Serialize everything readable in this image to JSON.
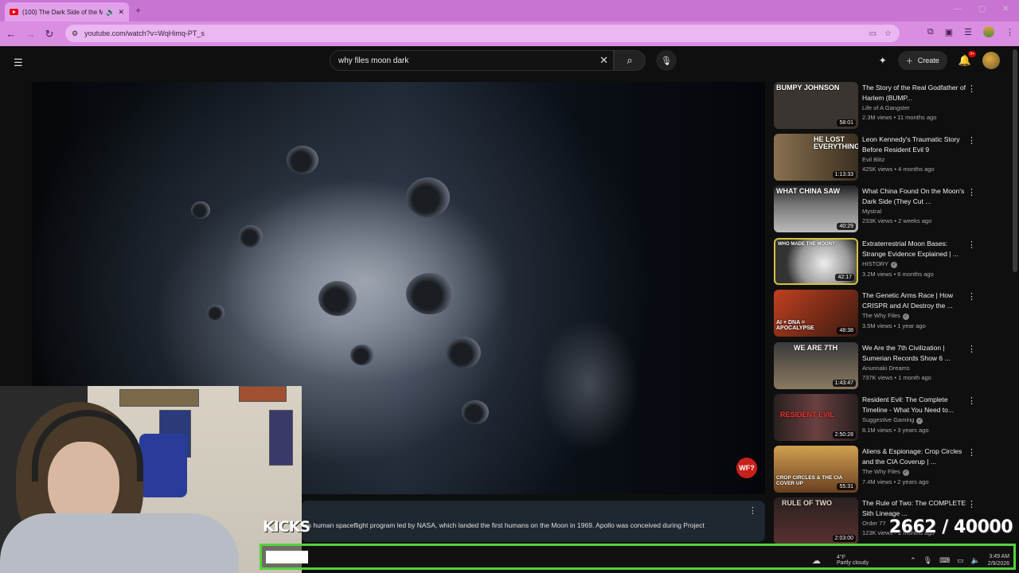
{
  "browser": {
    "tab_title": "(100) The Dark Side of the M",
    "url": "youtube.com/watch?v=WqHimq-PT_s",
    "new_tab_glyph": "+",
    "window_controls": [
      "—",
      "▢",
      "✕"
    ]
  },
  "youtube": {
    "search_query": "why files moon dark",
    "create_label": "Create",
    "notification_count": "9+"
  },
  "player": {
    "channel_badge": "WF?"
  },
  "description": {
    "text": "es human spaceflight program led by NASA, which landed the first humans on the Moon in 1969. Apollo was conceived during Project"
  },
  "recommendations": [
    {
      "title": "The Story of the Real Godfather of Harlem (BUMP...",
      "channel": "Life of A Gangster",
      "meta": "2.3M views • 11 months ago",
      "duration": "58:01",
      "thumb_text": "BUMPY JOHNSON",
      "verified": false,
      "thumb_bg": "#3a3530"
    },
    {
      "title": "Leon Kennedy's Traumatic Story Before Resident Evil 9",
      "channel": "Evil Blitz",
      "meta": "425K views • 4 months ago",
      "duration": "1:13:33",
      "thumb_text": "HE LOST EVERYTHING",
      "verified": false,
      "thumb_bg": "#6b5a40"
    },
    {
      "title": "What China Found On the Moon's Dark Side (They Cut ...",
      "channel": "Mystral",
      "meta": "233K views • 2 weeks ago",
      "duration": "40:29",
      "thumb_text": "WHAT CHINA SAW",
      "verified": false,
      "thumb_bg": "#8a8a8a"
    },
    {
      "title": "Extraterrestrial Moon Bases: Strange Evidence Explained | ...",
      "channel": "HISTORY",
      "meta": "3.2M views • 6 months ago",
      "duration": "42:17",
      "thumb_text": "WHO MADE THE MOON?",
      "verified": true,
      "thumb_bg": "#cfcfcf"
    },
    {
      "title": "The Genetic Arms Race | How CRISPR and AI Destroy the ...",
      "channel": "The Why Files",
      "meta": "3.5M views • 1 year ago",
      "duration": "48:38",
      "thumb_text": "AI + DNA = APOCALYPSE",
      "verified": true,
      "thumb_bg": "#7a3020"
    },
    {
      "title": "We Are the 7th Civilization | Sumerian Records Show 6 ...",
      "channel": "Anunnaki Dreams",
      "meta": "737K views • 1 month ago",
      "duration": "1:43:47",
      "thumb_text": "WE ARE 7TH",
      "verified": false,
      "thumb_bg": "#5a5040"
    },
    {
      "title": "Resident Evil: The Complete Timeline - What You Need to...",
      "channel": "Suggestive Gaming",
      "meta": "8.1M views • 3 years ago",
      "duration": "2:50:28",
      "thumb_text": "RESIDENT EVIL",
      "verified": true,
      "thumb_bg": "#4a3a38"
    },
    {
      "title": "Aliens & Espionage: Crop Circles and the CIA Coverup | ...",
      "channel": "The Why Files",
      "meta": "7.4M views • 2 years ago",
      "duration": "55:31",
      "thumb_text": "CROP CIRCLES & THE CIA COVER UP",
      "verified": true,
      "thumb_bg": "#9a6a30"
    },
    {
      "title": "The Rule of Two: The COMPLETE Sith Lineage ...",
      "channel": "Order 77",
      "meta": "123K views • 2 months ago",
      "duration": "2:03:00",
      "thumb_text": "RULE OF TWO",
      "verified": false,
      "thumb_bg": "#3a2a2a"
    }
  ],
  "overlay": {
    "kicks_label": "KICKS",
    "counter": "2662 / 40000",
    "progress_fraction": 0.0666,
    "accent_color": "#55d23c"
  },
  "taskbar": {
    "temperature": "4°F",
    "weather": "Partly cloudy",
    "time": "3:49 AM",
    "date": "2/9/2026"
  },
  "colors": {
    "tabbar": "#c774d2",
    "addressbar": "#d98ee2",
    "yt_background": "#0f0f0f"
  }
}
